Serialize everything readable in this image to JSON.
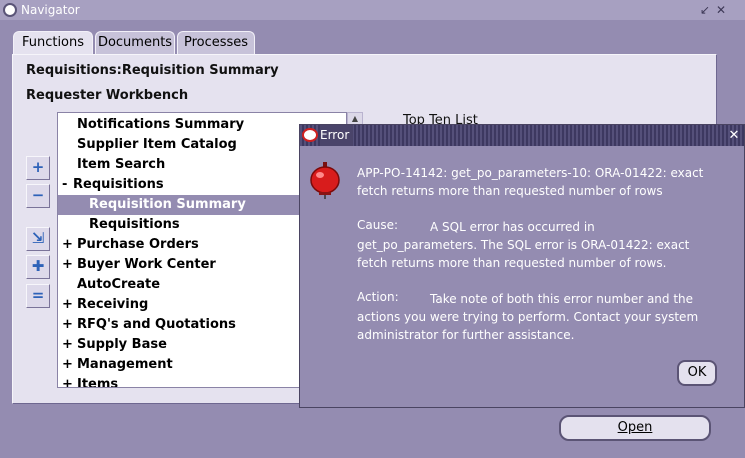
{
  "window": {
    "title": "Navigator",
    "controls": [
      "↙",
      "✕"
    ]
  },
  "tabs": [
    {
      "label": "Functions",
      "active": true
    },
    {
      "label": "Documents",
      "active": false
    },
    {
      "label": "Processes",
      "active": false
    }
  ],
  "panel": {
    "breadcrumb": "Requisitions:Requisition Summary",
    "heading": "Requester Workbench",
    "top_ten_label": "Top Ten List"
  },
  "tree": {
    "items": [
      {
        "sign": "",
        "label": "Notifications Summary",
        "selected": false
      },
      {
        "sign": "",
        "label": "Supplier Item Catalog",
        "selected": false
      },
      {
        "sign": "",
        "label": "Item Search",
        "selected": false
      },
      {
        "sign": "-",
        "label": "Requisitions",
        "selected": false
      },
      {
        "sign": "",
        "label": "Requisition Summary",
        "selected": true
      },
      {
        "sign": "",
        "label": "Requisitions",
        "selected": false
      },
      {
        "sign": "+",
        "label": "Purchase Orders",
        "selected": false
      },
      {
        "sign": "+",
        "label": "Buyer Work Center",
        "selected": false
      },
      {
        "sign": "",
        "label": "AutoCreate",
        "selected": false
      },
      {
        "sign": "+",
        "label": "Receiving",
        "selected": false
      },
      {
        "sign": "+",
        "label": "RFQ's and Quotations",
        "selected": false
      },
      {
        "sign": "+",
        "label": "Supply Base",
        "selected": false
      },
      {
        "sign": "+",
        "label": "Management",
        "selected": false
      },
      {
        "sign": "+",
        "label": "Items",
        "selected": false
      }
    ]
  },
  "side_buttons": {
    "expand": "+",
    "collapse": "−",
    "expand_branch": "⇲",
    "expand_all": "✚",
    "collapse_all": "="
  },
  "open_button": {
    "label": "Open"
  },
  "error_dialog": {
    "title": "Error",
    "message": "APP-PO-14142: get_po_parameters-10: ORA-01422: exact fetch returns more than requested number of rows",
    "cause_key": "Cause:",
    "cause_text": "A SQL error has occurred in get_po_parameters. The SQL error is ORA-01422: exact fetch returns more than requested number of rows.",
    "action_key": "Action:",
    "action_text": "Take note of both this error number and the actions you were trying to perform. Contact your system administrator for further assistance.",
    "ok_label": "OK",
    "close_glyph": "✕"
  }
}
